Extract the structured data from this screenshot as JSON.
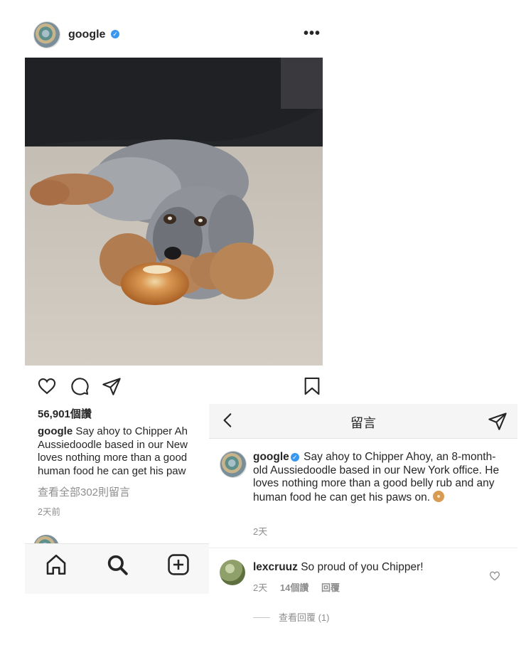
{
  "post": {
    "username": "google",
    "more_label": "•••",
    "likes": "56,901個讚",
    "caption_username": "google",
    "caption_line1": "Say ahoy to Chipper Ah",
    "caption_line2": "Aussiedoodle based in our New",
    "caption_line3": "loves nothing more than a good",
    "caption_line4": "human food he can get his paw",
    "view_all_comments": "查看全部302則留言",
    "time": "2天前"
  },
  "icons": {
    "like": "heart-icon",
    "comment": "comment-icon",
    "share": "paper-plane-icon",
    "save": "bookmark-icon",
    "home": "home-icon",
    "search": "search-icon",
    "create": "plus-square-icon"
  },
  "comments_panel": {
    "title": "留言",
    "caption": {
      "username": "google",
      "text": "Say ahoy to Chipper Ahoy, an 8-month-old Aussiedoodle based in our New York office. He loves nothing more than a good belly rub and any human food he can get his paws on.",
      "time": "2天"
    },
    "comments": [
      {
        "username": "lexcruuz",
        "text": "So proud of you Chipper!",
        "time": "2天",
        "likes": "14個讚",
        "reply_label": "回覆",
        "view_replies": "查看回覆 (1)"
      }
    ]
  },
  "colors": {
    "text": "#262626",
    "secondary": "#8e8e8e",
    "verified": "#3897f0"
  }
}
